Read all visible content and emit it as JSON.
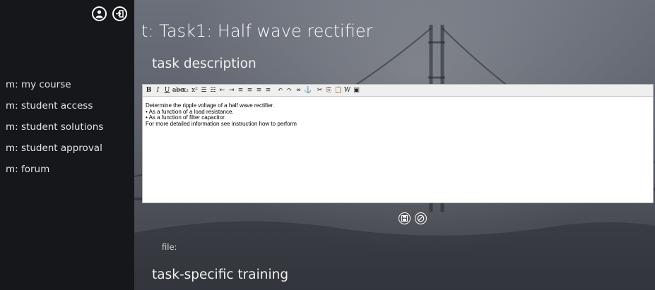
{
  "sidebar": {
    "icons": [
      "user-icon",
      "logout-icon"
    ],
    "items": [
      {
        "label": "m: my course"
      },
      {
        "label": "m: student access"
      },
      {
        "label": "m: student solutions"
      },
      {
        "label": "m: student approval"
      },
      {
        "label": "m: forum"
      }
    ]
  },
  "main": {
    "title": "t: Task1: Half wave rectifier",
    "task_description_heading": "task description",
    "file_label": "file:",
    "training_heading": "task-specific training"
  },
  "editor": {
    "toolbar": [
      {
        "label": "B",
        "icon": "bold-icon"
      },
      {
        "label": "I",
        "icon": "italic-icon"
      },
      {
        "label": "U",
        "icon": "underline-icon"
      },
      {
        "label": "abc",
        "icon": "strikethrough-icon"
      },
      {
        "label": "x₂",
        "icon": "subscript-icon"
      },
      {
        "label": "x²",
        "icon": "superscript-icon"
      },
      {
        "label": "☰",
        "icon": "bullet-list-icon"
      },
      {
        "label": "☷",
        "icon": "numbered-list-icon"
      },
      {
        "label": "⇤",
        "icon": "outdent-icon"
      },
      {
        "label": "⇥",
        "icon": "indent-icon"
      },
      {
        "label": "≡",
        "icon": "align-left-icon"
      },
      {
        "label": "≡",
        "icon": "align-center-icon"
      },
      {
        "label": "≡",
        "icon": "align-right-icon"
      },
      {
        "label": "≡",
        "icon": "justify-icon"
      },
      {
        "label": "↶",
        "icon": "undo-icon"
      },
      {
        "label": "↷",
        "icon": "redo-icon"
      },
      {
        "label": "∞",
        "icon": "link-icon"
      },
      {
        "label": "⚓",
        "icon": "anchor-icon"
      },
      {
        "label": "✂",
        "icon": "cut-icon"
      },
      {
        "label": "⎘",
        "icon": "copy-icon"
      },
      {
        "label": "📋",
        "icon": "paste-icon"
      },
      {
        "label": "W",
        "icon": "paste-word-icon"
      },
      {
        "label": "▣",
        "icon": "html-source-icon"
      }
    ],
    "lines": [
      "Determine the ripple voltage of a half wave rectifier.",
      "• As a function of a load resistance.",
      "• As a function of filter capacitor.",
      "For more detailed information see instruction how to perform"
    ]
  },
  "actions": [
    "save-icon",
    "cancel-icon"
  ],
  "colors": {
    "sidebar_bg": "#15171b",
    "text": "#ffffff"
  }
}
